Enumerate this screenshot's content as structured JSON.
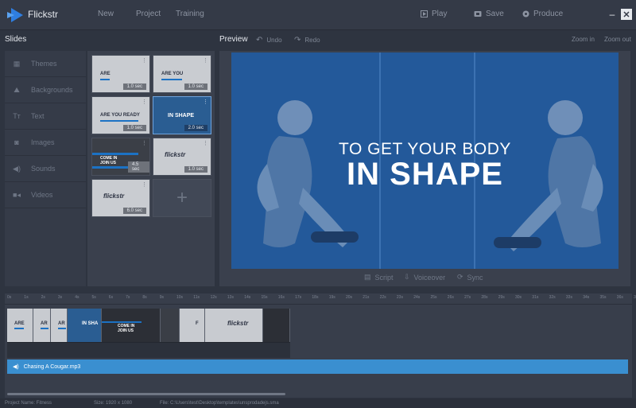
{
  "app": {
    "title": "Flickstr",
    "brand_color": "#2f7ee0"
  },
  "menu": [
    {
      "label": "New"
    },
    {
      "label": "Project"
    },
    {
      "label": "Training"
    }
  ],
  "actions": [
    {
      "label": "Play",
      "icon": "play-icon"
    },
    {
      "label": "Save",
      "icon": "save-icon"
    },
    {
      "label": "Produce",
      "icon": "produce-icon"
    }
  ],
  "window": {
    "minimize": "–",
    "close": "✕"
  },
  "slides_panel": {
    "title": "Slides"
  },
  "sidebar": {
    "items": [
      {
        "label": "Themes",
        "icon": "themes-icon",
        "glyph": "▦"
      },
      {
        "label": "Backgrounds",
        "icon": "backgrounds-icon",
        "glyph": "⛰"
      },
      {
        "label": "Text",
        "icon": "text-icon",
        "glyph": "Tт"
      },
      {
        "label": "Images",
        "icon": "images-icon",
        "glyph": "◙"
      },
      {
        "label": "Sounds",
        "icon": "sounds-icon",
        "glyph": "◀)"
      },
      {
        "label": "Videos",
        "icon": "videos-icon",
        "glyph": "■◂"
      }
    ]
  },
  "slides": [
    {
      "title": "ARE",
      "duration": "1.0 sec"
    },
    {
      "title": "ARE YOU",
      "duration": "1.0 sec"
    },
    {
      "title": "ARE YOU READY",
      "duration": "1.0 sec"
    },
    {
      "title": "IN SHAPE",
      "duration": "2.0 sec"
    },
    {
      "title": "COME IN JOIN US",
      "duration": "4.5 sec"
    },
    {
      "title": "flickstr",
      "duration": "1.0 sec"
    },
    {
      "title": "flickstr",
      "duration": "6.0 sec"
    }
  ],
  "preview": {
    "title": "Preview",
    "undo": "Undo",
    "redo": "Redo",
    "zoom_in": "Zoom in",
    "zoom_out": "Zoom out",
    "line1": "TO GET YOUR BODY",
    "line2": "IN SHAPE",
    "footer": {
      "script": "Script",
      "voiceover": "Voiceover",
      "sync": "Sync"
    }
  },
  "timeline": {
    "ticks": [
      "0s",
      "1s",
      "2s",
      "3s",
      "4s",
      "5s",
      "6s",
      "7s",
      "8s",
      "9s",
      "10s",
      "11s",
      "12s",
      "13s",
      "14s",
      "15s",
      "16s",
      "17s",
      "18s",
      "19s",
      "20s",
      "21s",
      "22s",
      "23s",
      "24s",
      "25s",
      "26s",
      "27s",
      "28s",
      "29s",
      "30s",
      "31s",
      "32s",
      "33s",
      "34s",
      "35s",
      "36s",
      "37s"
    ],
    "clips": [
      {
        "title": "ARE"
      },
      {
        "title": "AR"
      },
      {
        "title": "AR"
      },
      {
        "title": "IN SHA"
      },
      {
        "title": "COME IN JOIN US"
      },
      {
        "title": ""
      },
      {
        "title": "F"
      },
      {
        "title": "flickstr"
      },
      {
        "title": ""
      }
    ],
    "audio_track": "Chasing A Cougar.mp3"
  },
  "status": {
    "project": "Project Name: Fitness",
    "size": "Size: 1920 x 1080",
    "file": "File: C:\\Users\\test\\Desktop\\templates\\unsprodadejs.sma"
  }
}
